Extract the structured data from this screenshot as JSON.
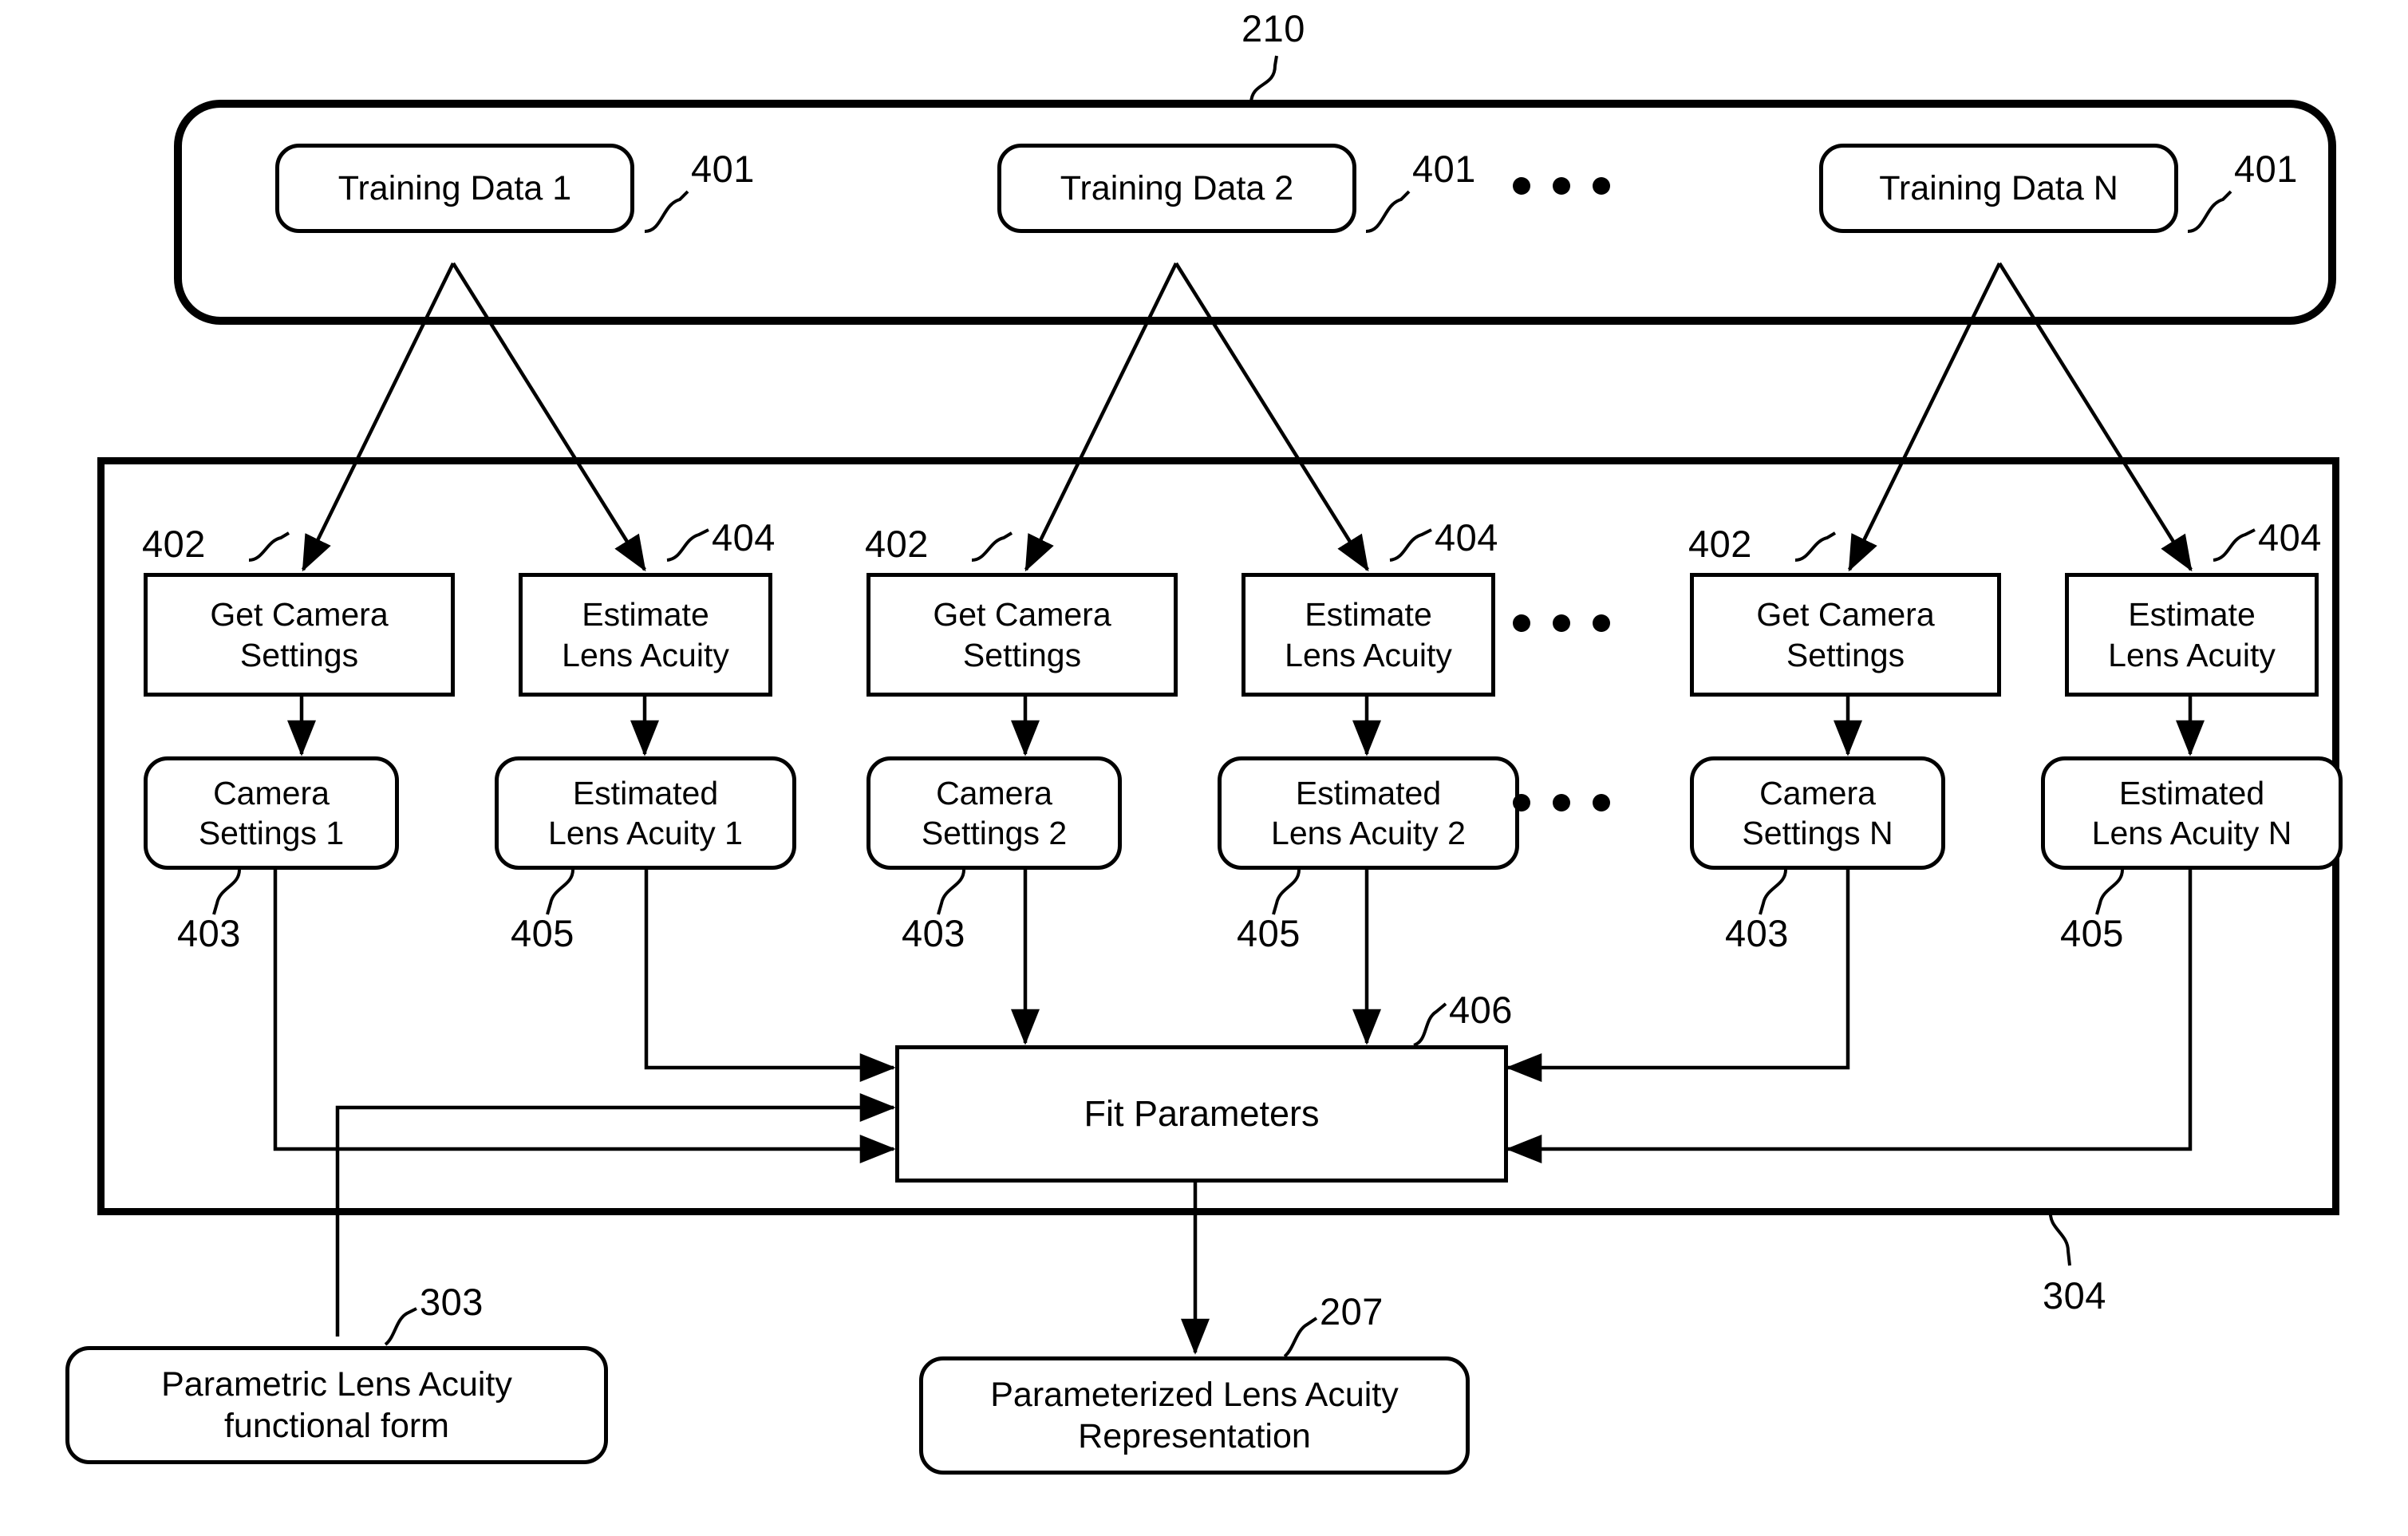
{
  "figure": {
    "title": "Lens Acuity Parameter Fitting Flow Diagram",
    "refnums": {
      "training_group": "210",
      "training_data_1": "401",
      "training_data_2": "401",
      "training_data_n": "401",
      "get_camera_settings_1": "402",
      "get_camera_settings_2": "402",
      "get_camera_settings_n": "402",
      "estimate_lens_acuity_1": "404",
      "estimate_lens_acuity_2": "404",
      "estimate_lens_acuity_n": "404",
      "camera_settings_1": "403",
      "camera_settings_2": "403",
      "camera_settings_n": "403",
      "estimated_lens_acuity_1": "405",
      "estimated_lens_acuity_2": "405",
      "estimated_lens_acuity_n": "405",
      "fit_parameters": "406",
      "parametric_form": "303",
      "parameterized_rep": "207",
      "process_group": "304"
    },
    "training_group": {
      "items": [
        {
          "label": "Training Data 1"
        },
        {
          "label": "Training Data 2"
        },
        {
          "label": "Training Data N"
        }
      ],
      "ellipsis": "•••"
    },
    "columns": [
      {
        "get_camera_settings": "Get Camera\nSettings",
        "estimate_lens_acuity": "Estimate\nLens Acuity",
        "camera_settings": "Camera\nSettings 1",
        "estimated_lens_acuity": "Estimated\nLens Acuity 1"
      },
      {
        "get_camera_settings": "Get Camera\nSettings",
        "estimate_lens_acuity": "Estimate\nLens Acuity",
        "camera_settings": "Camera\nSettings 2",
        "estimated_lens_acuity": "Estimated\nLens Acuity 2"
      },
      {
        "get_camera_settings": "Get Camera\nSettings",
        "estimate_lens_acuity": "Estimate\nLens Acuity",
        "camera_settings": "Camera\nSettings N",
        "estimated_lens_acuity": "Estimated\nLens Acuity N"
      }
    ],
    "fit_parameters": {
      "label": "Fit Parameters"
    },
    "parametric_form": {
      "label": "Parametric Lens Acuity\nfunctional form"
    },
    "parameterized_representation": {
      "label": "Parameterized Lens Acuity\nRepresentation"
    },
    "colors": {
      "ink": "#000000",
      "paper": "#ffffff"
    }
  }
}
